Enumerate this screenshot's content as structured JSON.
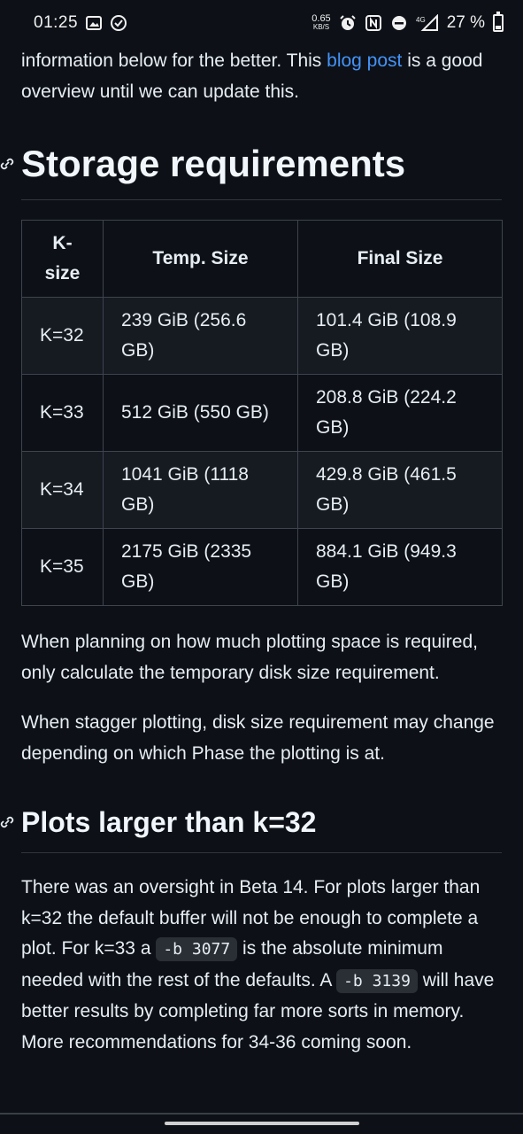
{
  "status_bar": {
    "time": "01:25",
    "net_speed": "0.65",
    "net_unit": "KB/S",
    "network": "4G",
    "battery": "27 %",
    "battery_level": 0.27
  },
  "intro": {
    "text_before": "information below for the better. This ",
    "link": "blog post",
    "text_after": " is a good overview until we can update this."
  },
  "storage": {
    "heading": "Storage requirements",
    "table": {
      "headers": [
        "K-size",
        "Temp. Size",
        "Final Size"
      ],
      "rows": [
        [
          "K=32",
          "239 GiB (256.6 GB)",
          "101.4 GiB (108.9 GB)"
        ],
        [
          "K=33",
          "512 GiB (550 GB)",
          "208.8 GiB (224.2 GB)"
        ],
        [
          "K=34",
          "1041 GiB (1118 GB)",
          "429.8 GiB (461.5 GB)"
        ],
        [
          "K=35",
          "2175 GiB (2335 GB)",
          "884.1 GiB (949.3 GB)"
        ]
      ]
    },
    "para1": "When planning on how much plotting space is required, only calculate the temporary disk size requirement.",
    "para2": "When stagger plotting, disk size requirement may change depending on which Phase the plotting is at."
  },
  "plots": {
    "heading": "Plots larger than k=32",
    "t1": "There was an oversight in Beta 14. For plots larger than k=32 the default buffer will not be enough to complete a plot. For k=33 a ",
    "code1": "-b 3077",
    "t2": " is the absolute minimum needed with the rest of the defaults. A ",
    "code2": "-b 3139",
    "t3": " will have better results by completing far more sorts in memory. More recommendations for 34-36 coming soon."
  }
}
